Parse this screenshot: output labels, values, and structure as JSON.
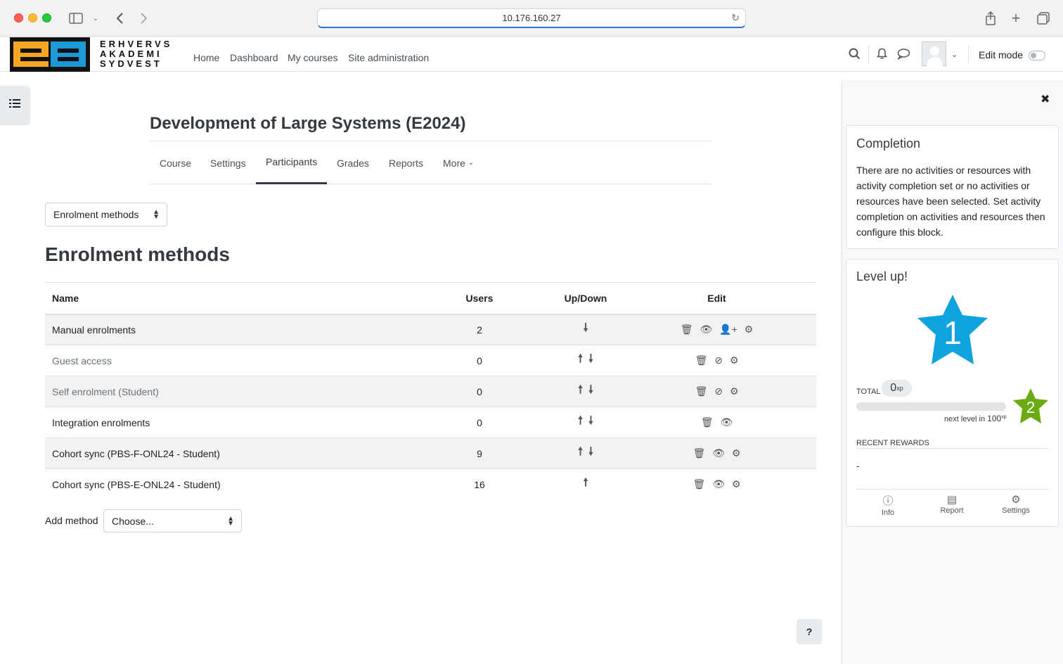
{
  "browser": {
    "url": "10.176.160.27"
  },
  "brand": {
    "line1": "ERHVERVS",
    "line2": "AKADEMI",
    "line3": "SYDVEST"
  },
  "nav": {
    "home": "Home",
    "dashboard": "Dashboard",
    "my_courses": "My courses",
    "site_admin": "Site administration",
    "edit_mode": "Edit mode"
  },
  "course": {
    "title": "Development of Large Systems (E2024)",
    "tabs": [
      "Course",
      "Settings",
      "Participants",
      "Grades",
      "Reports",
      "More"
    ],
    "active_tab": "Participants"
  },
  "page": {
    "selector_value": "Enrolment methods",
    "heading": "Enrolment methods"
  },
  "table": {
    "headers": [
      "Name",
      "Users",
      "Up/Down",
      "Edit"
    ],
    "rows": [
      {
        "name": "Manual enrolments",
        "users": "2"
      },
      {
        "name": "Guest access",
        "users": "0"
      },
      {
        "name": "Self enrolment (Student)",
        "users": "0"
      },
      {
        "name": "Integration enrolments",
        "users": "0"
      },
      {
        "name": "Cohort sync (PBS-F-ONL24 - Student)",
        "users": "9"
      },
      {
        "name": "Cohort sync (PBS-E-ONL24 - Student)",
        "users": "16"
      }
    ]
  },
  "add_method": {
    "label": "Add method",
    "value": "Choose..."
  },
  "help": "?",
  "completion": {
    "title": "Completion",
    "text": "There are no activities or resources with activity completion set or no activities or resources have been selected. Set activity completion on activities and resources then configure this block."
  },
  "levelup": {
    "title": "Level up!",
    "level": "1",
    "next_level": "2",
    "total_label": "TOTAL",
    "total_xp": "0",
    "xp_unit": "xp",
    "progress": 0,
    "next_label": "next level in",
    "next_xp": "100",
    "recent_label": "RECENT REWARDS",
    "recent_value": "-",
    "footer": [
      "Info",
      "Report",
      "Settings"
    ],
    "star_color": "#0fa3e0",
    "next_star_color": "#6aaa12"
  },
  "colors": {
    "text": "#1d2125",
    "link": "#495057",
    "row_stripe": "#f2f2f2",
    "url_focus": "#2f6fdf"
  }
}
